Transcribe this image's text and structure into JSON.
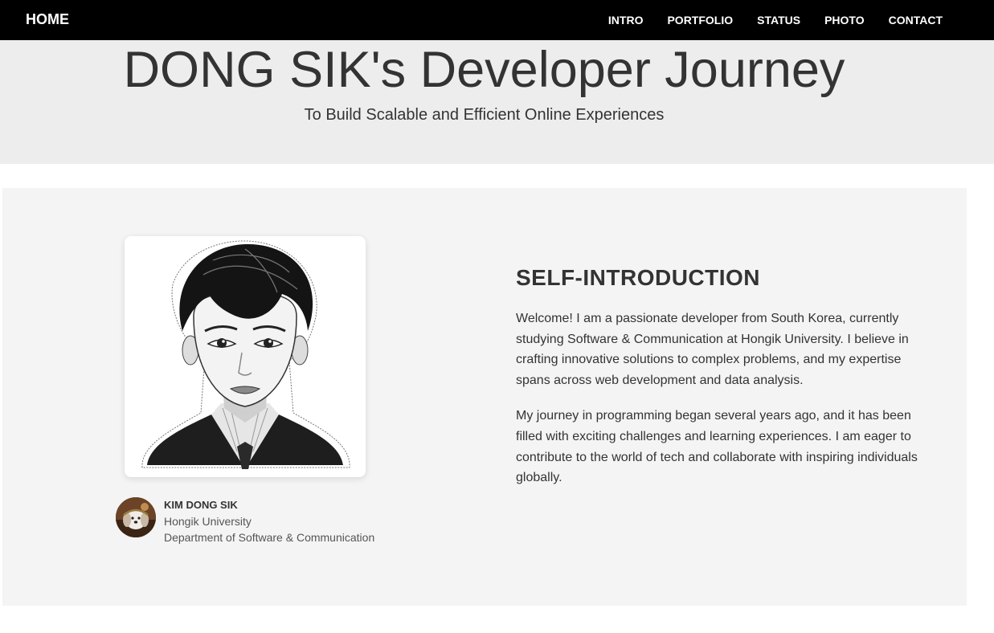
{
  "nav": {
    "home_label": "HOME",
    "links": [
      "INTRO",
      "PORTFOLIO",
      "STATUS",
      "PHOTO",
      "CONTACT"
    ]
  },
  "hero": {
    "title": "DONG SIK's Developer Journey",
    "subtitle": "To Build Scalable and Efficient Online Experiences"
  },
  "profile": {
    "name": "KIM DONG SIK",
    "university": "Hongik University",
    "department": "Department of Software & Communication"
  },
  "intro": {
    "heading": "SELF-INTRODUCTION",
    "paragraphs": [
      "Welcome! I am a passionate developer from South Korea, currently studying Software & Communication at Hongik University. I believe in crafting innovative solutions to complex problems, and my expertise spans across web development and data analysis.",
      "My journey in programming began several years ago, and it has been filled with exciting challenges and learning experiences. I am eager to contribute to the world of tech and collaborate with inspiring individuals globally."
    ]
  },
  "images": {
    "portrait": "illustrated-portrait",
    "avatar": "puppy-avatar"
  },
  "colors": {
    "navbar": "#000000",
    "hero_bg": "#ededed",
    "section_bg": "#f4f4f4",
    "text": "#333333"
  }
}
